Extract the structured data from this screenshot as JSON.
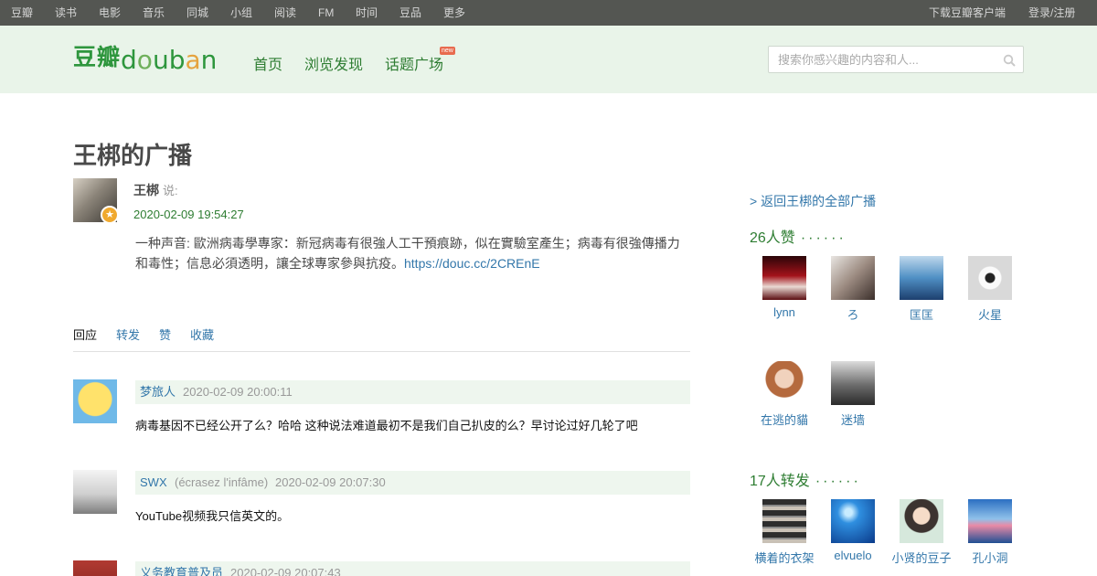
{
  "topbar": {
    "nav": [
      "豆瓣",
      "读书",
      "电影",
      "音乐",
      "同城",
      "小组",
      "阅读",
      "FM",
      "时间",
      "豆品",
      "更多"
    ],
    "download": "下载豆瓣客户端",
    "login": "登录/注册"
  },
  "header": {
    "logo_cn": "豆瓣",
    "logo_en": {
      "a": "d",
      "b": "o",
      "c": "u",
      "d": "b",
      "e": "a",
      "f": "n"
    },
    "nav": [
      "首页",
      "浏览发现",
      "话题广场"
    ],
    "new_badge": "new",
    "search_placeholder": "搜索你感兴趣的内容和人..."
  },
  "page_title": "王梆的广播",
  "status": {
    "user": "王梆",
    "said": "说:",
    "time": "2020-02-09 19:54:27",
    "text": "一种声音: 歐洲病毒學專家：新冠病毒有很強人工干預痕跡，似在實驗室產生；病毒有很強傳播力和毒性；信息必須透明，讓全球專家參與抗疫。",
    "link": "https://douc.cc/2CREnE"
  },
  "tabs": [
    "回应",
    "转发",
    "赞",
    "收藏"
  ],
  "comments": [
    {
      "user": "梦旅人",
      "extra": "",
      "time": "2020-02-09 20:00:11",
      "text": "病毒基因不已经公开了么？哈哈 这种说法难道最初不是我们自己扒皮的么？早讨论过好几轮了吧"
    },
    {
      "user": "SWX",
      "extra": "(écrasez l'infâme)",
      "time": "2020-02-09 20:07:30",
      "text": "YouTube视频我只信英文的。"
    },
    {
      "user": "义务教育普及员",
      "extra": "",
      "time": "2020-02-09 20:07:43",
      "text": ""
    }
  ],
  "sidebar": {
    "back": "> 返回王梆的全部广播",
    "likes_title": "26人赞",
    "likes_dots": "······",
    "likes": [
      "lynn",
      "ろ",
      "匡匡",
      "火星",
      "在逃的貓",
      "迷墙"
    ],
    "reshares_title": "17人转发",
    "reshares_dots": "······",
    "reshares": [
      "横着的衣架",
      "elvuelo",
      "小贤的豆子",
      "孔小洞"
    ]
  },
  "colors": {
    "brand_green": "#2e7d32",
    "link_blue": "#3377aa",
    "topbar": "#545652",
    "header_bg": "#e9f4e9"
  }
}
